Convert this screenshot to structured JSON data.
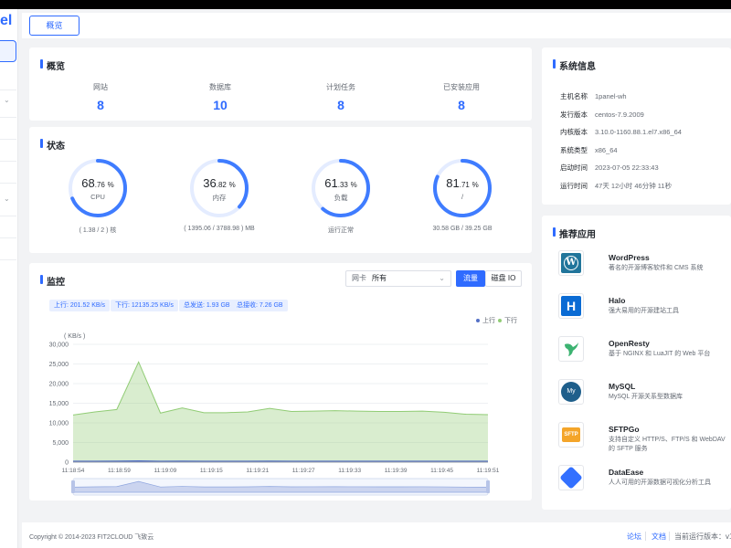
{
  "sidebar": {
    "logo_fragment": "el"
  },
  "header": {
    "tab_overview": "概览"
  },
  "overview": {
    "title": "概览",
    "items": [
      {
        "label": "网站",
        "value": "8"
      },
      {
        "label": "数据库",
        "value": "10"
      },
      {
        "label": "计划任务",
        "value": "8"
      },
      {
        "label": "已安装应用",
        "value": "8"
      }
    ]
  },
  "status": {
    "title": "状态",
    "gauges": [
      {
        "int": "68",
        "dec": ".76",
        "unit": "%",
        "name": "CPU",
        "foot": "( 1.38 / 2 ) 核",
        "percent": 68.76
      },
      {
        "int": "36",
        "dec": ".82",
        "unit": "%",
        "name": "内存",
        "foot": "( 1395.06 / 3788.98 ) MB",
        "percent": 36.82
      },
      {
        "int": "61",
        "dec": ".33",
        "unit": "%",
        "name": "负载",
        "foot": "运行正常",
        "percent": 61.33
      },
      {
        "int": "81",
        "dec": ".71",
        "unit": "%",
        "name": "/",
        "foot": "30.58 GB / 39.25 GB",
        "percent": 81.71
      }
    ]
  },
  "monitor": {
    "title": "监控",
    "select_label": "网卡",
    "select_value": "所有",
    "btn_flow": "流量",
    "btn_disk": "磁盘 IO",
    "tags": [
      "上行: 201.52 KB/s",
      "下行: 12135.25 KB/s",
      "总发送: 1.93 GB",
      "总接收: 7.26 GB"
    ],
    "legend_up": "上行",
    "legend_down": "下行"
  },
  "chart_data": {
    "type": "area",
    "ylabel": "( KB/s )",
    "ylim": [
      0,
      30000
    ],
    "yticks": [
      "30,000",
      "25,000",
      "20,000",
      "15,000",
      "10,000",
      "5,000",
      "0"
    ],
    "x": [
      "11:18:54",
      "11:18:59",
      "11:19:09",
      "11:19:15",
      "11:19:21",
      "11:19:27",
      "11:19:33",
      "11:19:39",
      "11:19:45",
      "11:19:51"
    ],
    "series": [
      {
        "name": "下行",
        "color": "#91cc75",
        "values": [
          12000,
          12800,
          13400,
          25500,
          12500,
          13800,
          12600,
          12600,
          12800,
          13700,
          12900,
          13000,
          13100,
          13000,
          12900,
          12900,
          13000,
          12700,
          12200,
          12100
        ]
      },
      {
        "name": "上行",
        "color": "#5470c6",
        "values": [
          200,
          210,
          220,
          300,
          200,
          220,
          210,
          200,
          210,
          220,
          200,
          210,
          200,
          200,
          210,
          200,
          210,
          200,
          200,
          200
        ]
      }
    ]
  },
  "system_info": {
    "title": "系统信息",
    "rows": [
      {
        "k": "主机名称",
        "v": "1panel-wh"
      },
      {
        "k": "发行版本",
        "v": "centos-7.9.2009"
      },
      {
        "k": "内核版本",
        "v": "3.10.0-1160.88.1.el7.x86_64"
      },
      {
        "k": "系统类型",
        "v": "x86_64"
      },
      {
        "k": "启动时间",
        "v": "2023-07-05 22:33:43"
      },
      {
        "k": "运行时间",
        "v": "47天 12小时 46分钟 11秒"
      }
    ]
  },
  "recommend": {
    "title": "推荐应用",
    "apps": [
      {
        "name": "WordPress",
        "desc": "著名的开源博客软件和 CMS 系统",
        "icon": "wordpress-icon"
      },
      {
        "name": "Halo",
        "desc": "强大易用的开源建站工具",
        "icon": "halo-icon"
      },
      {
        "name": "OpenResty",
        "desc": "基于 NGINX 和 LuaJIT 的 Web 平台",
        "icon": "openresty-icon"
      },
      {
        "name": "MySQL",
        "desc": "MySQL 开源关系型数据库",
        "icon": "mysql-icon"
      },
      {
        "name": "SFTPGo",
        "desc": "支持自定义 HTTP/S、FTP/S 和 WebDAV 的 SFTP 服务",
        "icon": "sftpgo-icon"
      },
      {
        "name": "DataEase",
        "desc": "人人可用的开源数据可视化分析工具",
        "icon": "dataease-icon"
      }
    ]
  },
  "footer": {
    "copyright": "Copyright © 2014-2023 FIT2CLOUD 飞致云",
    "forum": "论坛",
    "docs": "文档",
    "version": "当前运行版本：v1"
  }
}
